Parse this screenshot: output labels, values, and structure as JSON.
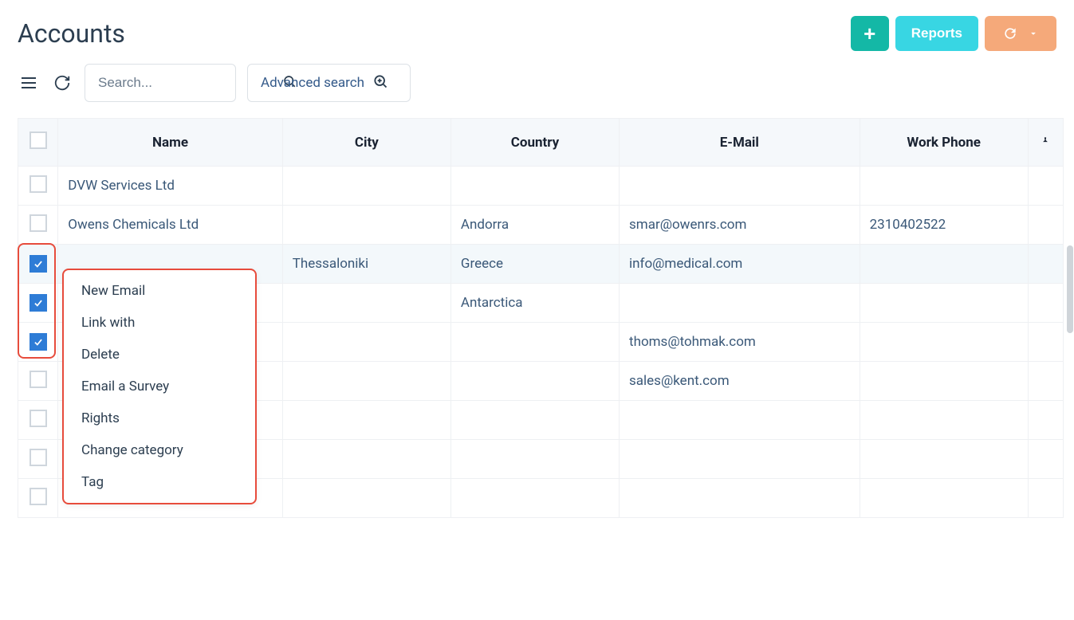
{
  "header": {
    "title": "Accounts",
    "reports_label": "Reports"
  },
  "toolbar": {
    "search_placeholder": "Search...",
    "advanced_label": "Advanced search"
  },
  "table": {
    "columns": {
      "name": "Name",
      "city": "City",
      "country": "Country",
      "email": "E-Mail",
      "phone": "Work Phone"
    },
    "rows": [
      {
        "checked": false,
        "highlight": false,
        "name": "DVW Services Ltd",
        "city": "",
        "country": "",
        "email": "",
        "phone": ""
      },
      {
        "checked": false,
        "highlight": false,
        "name": "Owens Chemicals Ltd",
        "city": "",
        "country": "Andorra",
        "email": "smar@owenrs.com",
        "phone": "2310402522"
      },
      {
        "checked": true,
        "highlight": true,
        "name": "",
        "city": "Thessaloniki",
        "country": "Greece",
        "email": "info@medical.com",
        "phone": ""
      },
      {
        "checked": true,
        "highlight": false,
        "name": "",
        "city": "",
        "country": "Antarctica",
        "email": "",
        "phone": ""
      },
      {
        "checked": true,
        "highlight": false,
        "name": "",
        "city": "",
        "country": "",
        "email": "thoms@tohmak.com",
        "phone": ""
      },
      {
        "checked": false,
        "highlight": false,
        "name": "",
        "city": "",
        "country": "",
        "email": "sales@kent.com",
        "phone": ""
      },
      {
        "checked": false,
        "highlight": false,
        "name": "",
        "city": "",
        "country": "",
        "email": "",
        "phone": ""
      },
      {
        "checked": false,
        "highlight": false,
        "name": "",
        "city": "",
        "country": "",
        "email": "",
        "phone": ""
      },
      {
        "checked": false,
        "highlight": false,
        "name": "",
        "city": "",
        "country": "",
        "email": "",
        "phone": ""
      }
    ]
  },
  "context_menu": {
    "items": [
      "New Email",
      "Link with",
      "Delete",
      "Email a Survey",
      "Rights",
      "Change category",
      "Tag"
    ]
  },
  "colors": {
    "accent_teal": "#14b8a6",
    "accent_cyan": "#38d6e3",
    "accent_orange": "#f5a97a",
    "highlight_red": "#e74c3c",
    "check_blue": "#2e7cd6"
  }
}
